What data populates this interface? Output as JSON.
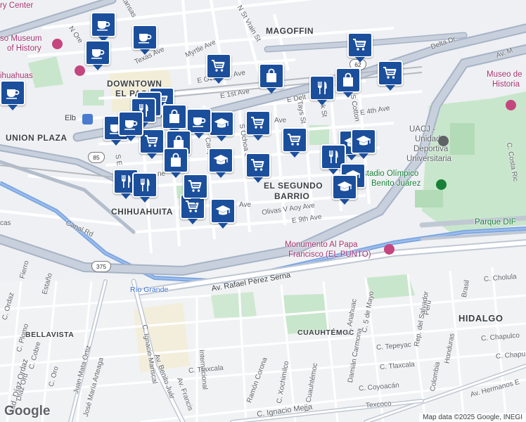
{
  "labels": {
    "neighborhoods": {
      "magoffin": "MAGOFFIN",
      "downtown_1": "DOWNTOWN",
      "downtown_2": "EL PASO",
      "union_plaza": "UNION PLAZA",
      "segundo_1": "EL SEGUNDO",
      "segundo_2": "BARRIO",
      "chihuahuita": "CHIHUAHUITA",
      "bellavista": "BELLAVISTA",
      "cuauhtemoc": "CUAUHTÉMOC",
      "hidalgo": "HIDALGO"
    },
    "poi": {
      "history_museum_1": "so Museum",
      "history_museum_2": "of History",
      "museo_1": "Museo de",
      "museo_2": "Historia",
      "uacj_1": "UACJ -",
      "uacj_2": "Unidad",
      "uacj_3": "Deportiva",
      "uacj_4": "Universitaria",
      "estadio_1": "stadio Olímpico",
      "estadio_2": "Benito Juárez",
      "parque": "Parque DIF",
      "monumento_1": "Monumento Al Papa",
      "monumento_2": "Francisco (EL PUNTO)",
      "center": "ry Center",
      "chihuahuas": "ihuahuas",
      "elb": "Elb",
      "rio": "Río Grande"
    },
    "streets": {
      "kansas": "Kansas",
      "n_oregon": "N Ore",
      "texas": "Texas Ave",
      "myrtle": "Myrtle Ave",
      "n_st_vrain": "N St Vrain St",
      "e_overland": "E Overland Ave",
      "e_1st": "E 1st Ave",
      "e_delta": "E Delt",
      "delta_dr": "Delta Dr",
      "av_m": "Av. M",
      "e_4th": "E 4th Ave",
      "s_cotton": "S Cotton",
      "tays": "Tays St",
      "ark": "ark St",
      "s_ochoa": "S Ochoa St",
      "campbell": "Campb St",
      "olivas": "Olivas V Aoy Ave",
      "e_9th": "E 9th Ave",
      "canal": "Canal Rd",
      "c_costa": "C. Costa Ric",
      "rafael": "Av. Rafael Pérez Serna",
      "c_cholula": "C. Cholula",
      "c_chapulco": "C. Chapulco",
      "c_chapu2": "C. Chapu",
      "c_tepeyac": "C. Tepeyac",
      "c_tlaxcala": "C. Tlaxcala",
      "c_tlaxcala2": "C. Tlaxcala",
      "c_coyoacan": "C. Coyoacán",
      "texcoco": "Texcoco",
      "hermanos": "Av. Hermanos E",
      "ignacio_mejia": "C. Ignacio Mejía",
      "ignacio_mariscal": "C. Ignacio Mariscal",
      "benito_juarez": "Av. Benito Juár",
      "av_francisco": "Av. Francis",
      "internacional": "Internacional",
      "c_oro": "C. Oro",
      "juan_mata": "Juan Mata Ortiz",
      "jose_maria": "José María Arteaga",
      "c_plomo": "C. Plomo",
      "c_cobre": "C. Cobre",
      "viad_diaz": "Viad. Díaz Ordaz",
      "diaz_ord": "Díaz Ord",
      "c_ordaz": "C. Ordaz",
      "fierro": "Fierro",
      "estano": "Estaño",
      "cas": "cas",
      "anahuac": "C. Anahuac",
      "damian": "Damián Carmona",
      "c5mayo": "C. 5 de Mayo",
      "colombia": "Colombia",
      "peru": "Perú",
      "honduras": "Honduras",
      "rep_salvador": "Rep. del Salvador",
      "brasil": "Brasil",
      "c_xochimilco": "C. Xochimilco",
      "c_cuauhtemoc": "C. Cuauhtémoc",
      "ramon_corona": "Ramón Corona",
      "s_e": "S E",
      "ave": "Ave",
      "ve": "ve",
      "ne": "ne",
      "ave2": "Ave"
    },
    "shields": {
      "s62": "62",
      "s85": "85",
      "s375": "375"
    }
  },
  "pins": [
    {
      "type": "cafe",
      "icon": "coffee-cup-icon"
    },
    {
      "type": "cafe",
      "icon": "coffee-cup-icon"
    },
    {
      "type": "cafe",
      "icon": "coffee-cup-icon"
    },
    {
      "type": "cafe",
      "icon": "coffee-cup-icon"
    },
    {
      "type": "grocery",
      "icon": "shopping-cart-icon"
    },
    {
      "type": "grocery",
      "icon": "shopping-cart-icon"
    },
    {
      "type": "shopping",
      "icon": "shopping-bag-icon"
    },
    {
      "type": "grocery",
      "icon": "shopping-cart-icon"
    },
    {
      "type": "restaurant",
      "icon": "fork-knife-icon"
    },
    {
      "type": "shopping",
      "icon": "shopping-bag-icon"
    },
    {
      "type": "grocery",
      "icon": "shopping-cart-icon"
    },
    {
      "type": "school",
      "icon": "graduation-cap-icon"
    },
    {
      "type": "grocery",
      "icon": "shopping-cart-icon"
    },
    {
      "type": "cafe",
      "icon": "coffee-cup-icon"
    },
    {
      "type": "school",
      "icon": "graduation-cap-icon"
    },
    {
      "type": "grocery",
      "icon": "shopping-cart-icon"
    },
    {
      "type": "school",
      "icon": "graduation-cap-icon"
    },
    {
      "type": "restaurant",
      "icon": "fork-knife-icon"
    },
    {
      "type": "school",
      "icon": "graduation-cap-icon"
    },
    {
      "type": "school",
      "icon": "graduation-cap-icon"
    },
    {
      "type": "grocery",
      "icon": "shopping-cart-icon"
    },
    {
      "type": "school",
      "icon": "graduation-cap-icon"
    },
    {
      "type": "grocery",
      "icon": "shopping-cart-icon"
    },
    {
      "type": "shopping",
      "icon": "shopping-bag-icon"
    },
    {
      "type": "restaurant",
      "icon": "fork-knife-icon"
    },
    {
      "type": "grocery",
      "icon": "shopping-cart-icon"
    },
    {
      "type": "shopping",
      "icon": "shopping-bag-icon"
    },
    {
      "type": "school",
      "icon": "graduation-cap-icon"
    },
    {
      "type": "grocery",
      "icon": "shopping-cart-icon"
    },
    {
      "type": "shopping",
      "icon": "shopping-bag-icon"
    },
    {
      "type": "restaurant",
      "icon": "fork-knife-icon"
    },
    {
      "type": "restaurant",
      "icon": "fork-knife-icon"
    },
    {
      "type": "cafe",
      "icon": "coffee-cup-icon"
    },
    {
      "type": "cafe",
      "icon": "coffee-cup-icon"
    },
    {
      "type": "grocery",
      "icon": "shopping-cart-icon"
    }
  ],
  "attribution": "Map data ©2025 Google, INEGI",
  "logo": "Google",
  "colors": {
    "pin": "#1b4f9c",
    "highway": "#a7b3c6",
    "park": "#bfe3c4",
    "land": "#eef0f3",
    "border": "#6f8fcf"
  }
}
